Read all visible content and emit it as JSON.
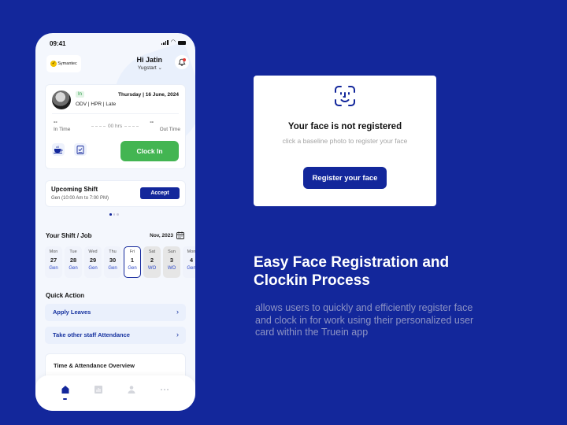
{
  "colors": {
    "background": "#13279b",
    "primary": "#13279b",
    "clock_in_green": "#43b552",
    "badge_green": "#2e9a4a",
    "notification_red": "#e53935"
  },
  "phone": {
    "status_bar": {
      "time": "09:41"
    },
    "header": {
      "company_logo_text": "Symantec",
      "greeting": "Hi Jatin",
      "organization": "Yugstart",
      "organization_chevron": "⌄"
    },
    "attendance_card": {
      "status_badge": "In",
      "date": "Thursday | 16 June, 2024",
      "tags": "ODV | HPR | Late",
      "in_time_value": "--",
      "in_time_label": "In Time",
      "duration": "00 hrs",
      "out_time_value": "--",
      "out_time_label": "Out Time",
      "clock_in_label": "Clock In"
    },
    "upcoming_shift": {
      "title": "Upcoming Shift",
      "subtitle": "Gen (10:00 Am to 7:00 PM)",
      "accept_label": "Accept",
      "carousel_active_index": 0,
      "carousel_count": 3
    },
    "shift_section": {
      "title": "Your Shift / Job",
      "month": "Nov, 2023",
      "days": [
        {
          "name": "Mon",
          "num": "27",
          "shift": "Gen",
          "type": "normal"
        },
        {
          "name": "Tue",
          "num": "28",
          "shift": "Gen",
          "type": "normal"
        },
        {
          "name": "Wed",
          "num": "29",
          "shift": "Gen",
          "type": "normal"
        },
        {
          "name": "Thu",
          "num": "30",
          "shift": "Gen",
          "type": "normal"
        },
        {
          "name": "Fri",
          "num": "1",
          "shift": "Gen",
          "type": "selected"
        },
        {
          "name": "Sat",
          "num": "2",
          "shift": "WO",
          "type": "weekoff"
        },
        {
          "name": "Sun",
          "num": "3",
          "shift": "WO",
          "type": "weekoff"
        },
        {
          "name": "Mon",
          "num": "4",
          "shift": "Gen",
          "type": "normal"
        }
      ]
    },
    "quick_action": {
      "title": "Quick Action",
      "items": [
        {
          "label": "Apply Leaves",
          "chevron": "›"
        },
        {
          "label": "Take other staff Attendance",
          "chevron": "›"
        }
      ]
    },
    "overview": {
      "title": "Time & Attendance Overview"
    },
    "bottom_nav": {
      "items": [
        "home-icon",
        "reports-icon",
        "profile-icon",
        "more-icon"
      ],
      "active": "home-icon"
    }
  },
  "face_card": {
    "title": "Your face is not registered",
    "description": "click a baseline photo to register your face",
    "button_label": "Register your face"
  },
  "marketing": {
    "headline_line1": "Easy Face Registration and",
    "headline_line2": "Clockin Process",
    "description": "allows users to quickly and efficiently register face and clock in for work using their personalized user card within the Truein app"
  }
}
